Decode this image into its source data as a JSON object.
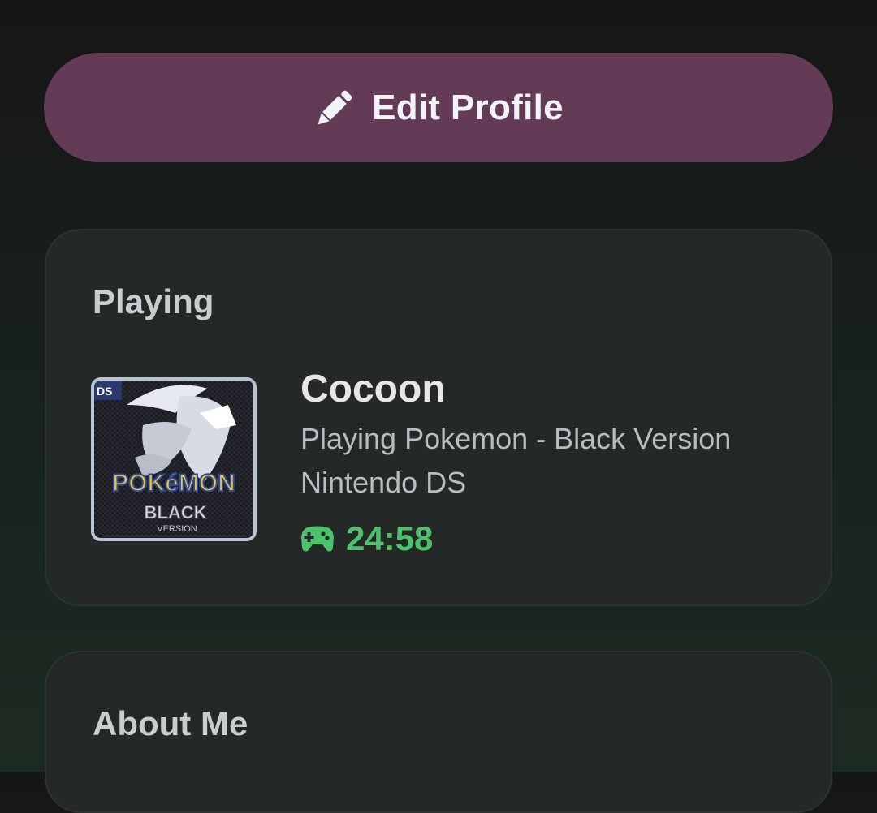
{
  "edit_profile": {
    "label": "Edit Profile",
    "icon": "pencil-icon"
  },
  "playing": {
    "title": "Playing",
    "cover": {
      "badge": "DS",
      "logo_text": "POKéMON",
      "edition_text": "BLACK",
      "version_text": "VERSION"
    },
    "game_title": "Cocoon",
    "details": [
      "Playing Pokemon - Black Version",
      "Nintendo DS"
    ],
    "timer_icon": "gamepad-icon",
    "elapsed": "24:58"
  },
  "about": {
    "title": "About Me"
  },
  "colors": {
    "button_bg": "#633b57",
    "card_bg": "#242928",
    "timer_green": "#4cc36a"
  }
}
